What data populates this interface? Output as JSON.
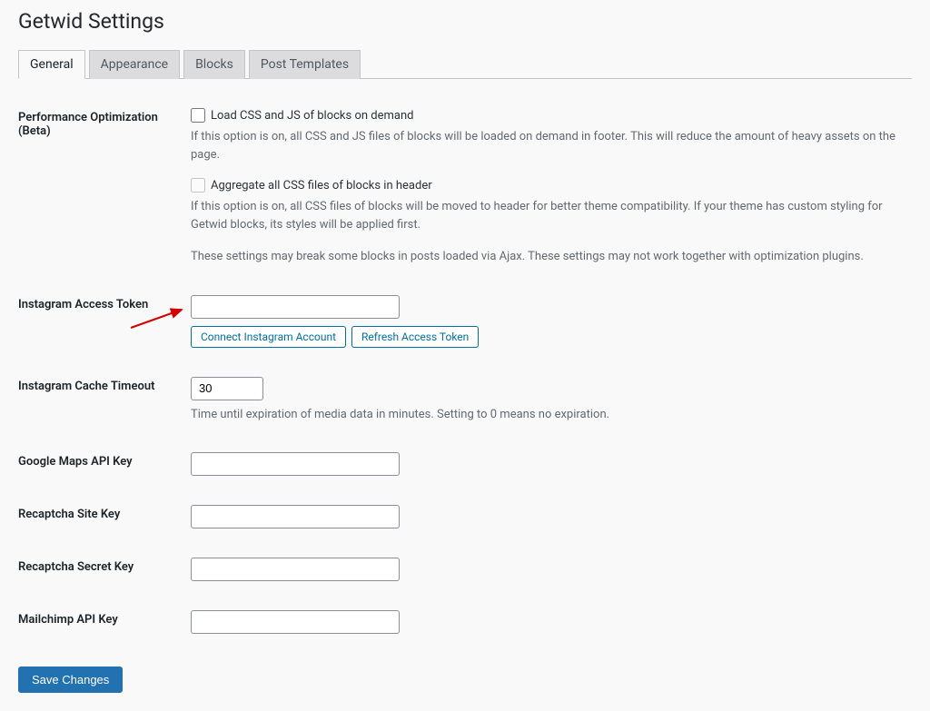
{
  "page": {
    "title": "Getwid Settings"
  },
  "tabs": {
    "general": "General",
    "appearance": "Appearance",
    "blocks": "Blocks",
    "post_templates": "Post Templates"
  },
  "perf": {
    "label": "Performance Optimization (Beta)",
    "load_on_demand_label": "Load CSS and JS of blocks on demand",
    "load_on_demand_desc": "If this option is on, all CSS and JS files of blocks will be loaded on demand in footer. This will reduce the amount of heavy assets on the page.",
    "aggregate_label": "Aggregate all CSS files of blocks in header",
    "aggregate_desc": "If this option is on, all CSS files of blocks will be moved to header for better theme compatibility. If your theme has custom styling for Getwid blocks, its styles will be applied first.",
    "note": "These settings may break some blocks in posts loaded via Ajax. These settings may not work together with optimization plugins."
  },
  "instagram_token": {
    "label": "Instagram Access Token",
    "value": "",
    "connect_btn": "Connect Instagram Account",
    "refresh_btn": "Refresh Access Token"
  },
  "instagram_cache": {
    "label": "Instagram Cache Timeout",
    "value": "30",
    "desc": "Time until expiration of media data in minutes. Setting to 0 means no expiration."
  },
  "google_maps": {
    "label": "Google Maps API Key",
    "value": ""
  },
  "recaptcha_site": {
    "label": "Recaptcha Site Key",
    "value": ""
  },
  "recaptcha_secret": {
    "label": "Recaptcha Secret Key",
    "value": ""
  },
  "mailchimp": {
    "label": "Mailchimp API Key",
    "value": ""
  },
  "save": {
    "label": "Save Changes"
  }
}
